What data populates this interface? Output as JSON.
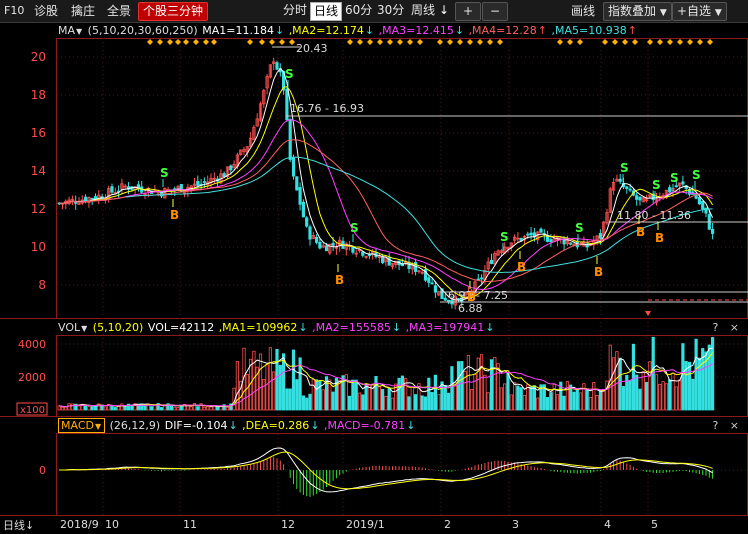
{
  "toolbar": {
    "f10": "F10",
    "diagnose": "诊股",
    "catch_dealer": "擒庄",
    "panorama": "全景",
    "minute_stock": "个股三分钟",
    "periods": [
      "分时",
      "日线",
      "60分",
      "30分",
      "周线"
    ],
    "selected_period": "日线",
    "period_down_arrow": "↓",
    "plus": "+",
    "minus": "−",
    "draw_line": "画线",
    "index_overlay": "指数叠加",
    "add_watch": "+自选"
  },
  "ma_panel": {
    "label": "MA",
    "params": "(5,10,20,30,60,250)",
    "ma1": "MA1=11.184",
    "ma2": ",MA2=12.174",
    "ma3": ",MA3=12.415",
    "ma4": ",MA4=12.28",
    "ma5": ",MA5=10.938",
    "arrow_down": "↓",
    "arrow_up": "↑",
    "y_ticks": [
      "20",
      "18",
      "16",
      "14",
      "12",
      "10",
      "8"
    ],
    "annotations": {
      "peak": "20.43",
      "range": "16.76 - 16.93",
      "low_range": "6.92 - 7.25",
      "low": "6.88",
      "right_range": "11.80 - 11.36"
    },
    "s_marker": "S",
    "b_marker": "B"
  },
  "vol_panel": {
    "label": "VOL",
    "params": "(5,10,20)",
    "vol": "VOL=42112",
    "ma1": ",MA1=109962",
    "ma2": ",MA2=155585",
    "ma3": ",MA3=197941",
    "arrow_down": "↓",
    "y_ticks": [
      "4000",
      "2000"
    ],
    "unit": "x100"
  },
  "macd_panel": {
    "label": "MACD",
    "params": "(26,12,9)",
    "dif": "DIF=-0.104",
    "dea": ",DEA=0.286",
    "macd": ",MACD=-0.781",
    "arrow_down": "↓",
    "y_tick": "0"
  },
  "panel_icons": "? ×",
  "bottom": {
    "period": "日线",
    "period_arrow": "↓",
    "dates": [
      "2018/9",
      "10",
      "11",
      "12",
      "2019/1",
      "2",
      "3",
      "4",
      "5"
    ]
  },
  "colors": {
    "up": "#ff5050",
    "down": "#34e0e0",
    "ma1": "#ffffff",
    "ma2": "#ffff00",
    "ma3": "#ff40ff",
    "ma4": "#ff6060",
    "ma5": "#40e0e0",
    "accent": "#c00000"
  }
}
